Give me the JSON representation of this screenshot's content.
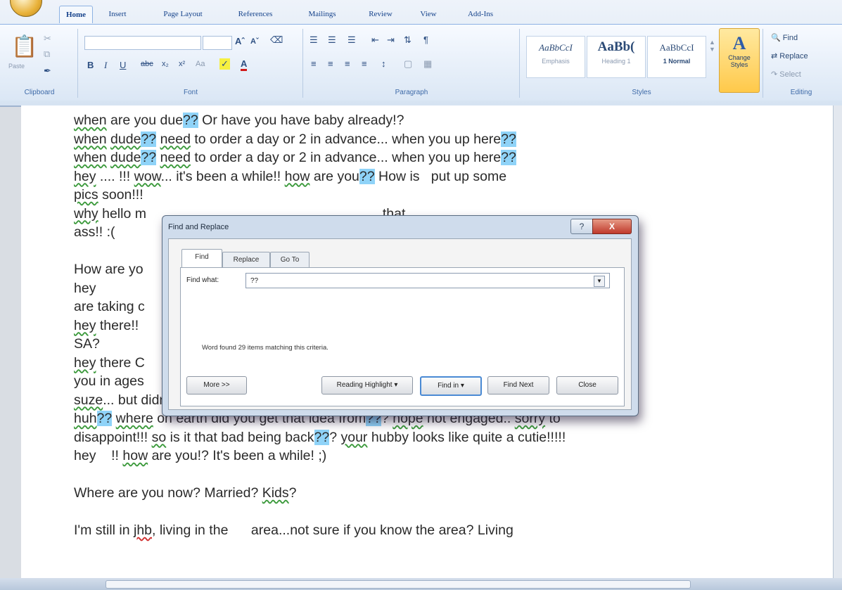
{
  "ribbon": {
    "tabs": [
      "Home",
      "Insert",
      "Page Layout",
      "References",
      "Mailings",
      "Review",
      "View",
      "Add-Ins"
    ],
    "groups": {
      "clipboard": "Clipboard",
      "font": "Font",
      "paragraph": "Paragraph",
      "styles": "Styles",
      "editing": "Editing"
    },
    "paste_label": "Paste",
    "style_samples": [
      {
        "sample": "AaBbCcI",
        "name": "Emphasis"
      },
      {
        "sample": "AaBb(",
        "name": "Heading 1"
      },
      {
        "sample": "AaBbCcI",
        "name": "1 Normal"
      }
    ],
    "change_styles": "Change Styles",
    "editing": {
      "find": "Find",
      "replace": "Replace",
      "select": "Select"
    }
  },
  "document": {
    "lines": [
      "when are you due?? Or have you have baby already!?",
      "when dude?? need to order a day or 2 in advance... when you up here??",
      "when dude?? need to order a day or 2 in advance... when you up here??",
      "hey ....  !!! wow... it's been a while!! how are you?? How is   put up some",
      "pics soon!!!",
      "why hello m                                                              that",
      "ass!! :(",
      "",
      "How are yo",
      "hey                                                                          e you",
      "are taking c",
      "hey there!!                                                                   ? still in",
      "SA?",
      "hey there C                                                                   into",
      "you in ages                                                                   ed into",
      "suze... but didn't see you.. think we had gone to get something to eat!!!",
      "huh?? where on earth did you get that idea from??? nope not engaged.. sorry to",
      "disappoint!!! so is it that bad being back??? your hubby looks like quite a cutie!!!!!",
      "hey    !! how are you!? It's been a while! ;)",
      "",
      "Where are you now? Married? Kids?",
      "",
      "I'm still in jhb, living in the      area...not sure if you know the area? Living"
    ]
  },
  "dialog": {
    "title": "Find and Replace",
    "help": "?",
    "close": "X",
    "tabs": [
      "Find",
      "Replace",
      "Go To"
    ],
    "find_what_label": "Find what:",
    "find_what_value": "??",
    "status": "Word found 29 items matching this criteria.",
    "buttons": {
      "more": "More >>",
      "reading_highlight": "Reading Highlight",
      "find_in": "Find in",
      "find_next": "Find Next",
      "close": "Close"
    }
  }
}
